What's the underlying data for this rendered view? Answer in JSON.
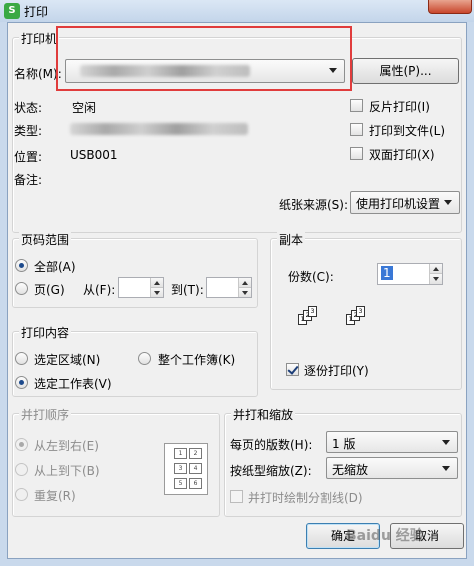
{
  "window": {
    "title": "打印",
    "app_icon_glyph": "S"
  },
  "printer": {
    "group_label": "打印机",
    "name_label": "名称(M):",
    "properties_button": "属性(P)...",
    "status_label": "状态:",
    "status_value": "空闲",
    "type_label": "类型:",
    "location_label": "位置:",
    "location_value": "USB001",
    "comment_label": "备注:",
    "options": [
      {
        "label": "反片打印(I)",
        "checked": false
      },
      {
        "label": "打印到文件(L)",
        "checked": false
      },
      {
        "label": "双面打印(X)",
        "checked": false
      }
    ],
    "paper_source_label": "纸张来源(S):",
    "paper_source_value": "使用打印机设置"
  },
  "page_range": {
    "group_label": "页码范围",
    "all_label": "全部(A)",
    "pages_label": "页(G)",
    "from_label": "从(F):",
    "to_label": "到(T):",
    "selected": "all",
    "from_value": "",
    "to_value": ""
  },
  "copies": {
    "group_label": "副本",
    "count_label": "份数(C):",
    "count_value": "1",
    "collate_label": "逐份打印(Y)",
    "collate_checked": true
  },
  "print_content": {
    "group_label": "打印内容",
    "selection_label": "选定区域(N)",
    "workbook_label": "整个工作簿(K)",
    "sheet_label": "选定工作表(V)",
    "selected": "sheet"
  },
  "print_order": {
    "group_label": "并打顺序",
    "ltr_label": "从左到右(E)",
    "ttb_label": "从上到下(B)",
    "repeat_label": "重复(R)",
    "selected": "ltr",
    "preview_pages": [
      "1",
      "2",
      "3",
      "4",
      "5",
      "6"
    ]
  },
  "zoom": {
    "group_label": "并打和缩放",
    "pages_per_sheet_label": "每页的版数(H):",
    "pages_per_sheet_value": "1 版",
    "scale_label": "按纸型缩放(Z):",
    "scale_value": "无缩放",
    "draw_lines_label": "并打时绘制分割线(D)"
  },
  "footer": {
    "ok_label": "确定",
    "cancel_label": "取消"
  },
  "watermark": "Baidu 经验",
  "colors": {
    "highlight": "#e03c3c",
    "title_bar": "#c9d9ec",
    "dialog_bg": "#f0f0f0"
  }
}
